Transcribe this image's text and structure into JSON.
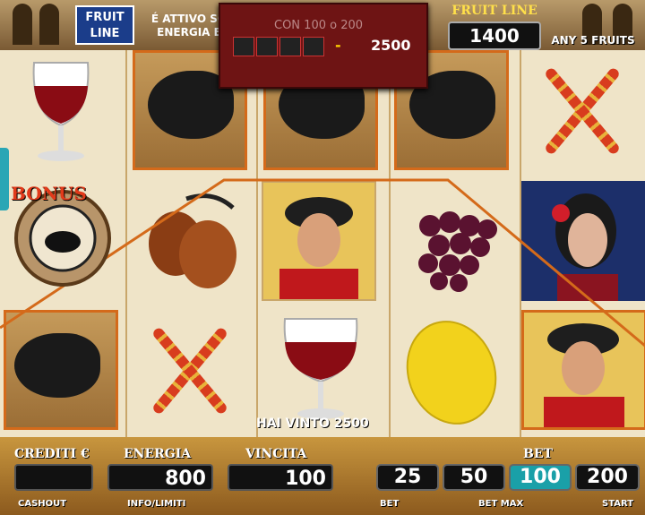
{
  "header": {
    "logo_line1": "FRUIT",
    "logo_line2": "LINE",
    "promo_line1": "É ATTIVO SO",
    "promo_line2": "ENERGIA E"
  },
  "win_popup": {
    "ghost_text": "CON  100 o 200",
    "symbol_count": 4,
    "symbol_icon": "bull-icon",
    "dash": "-",
    "payout": "2500"
  },
  "fruit_line": {
    "title": "FRUIT LINE",
    "value": "1400",
    "caption": "ANY 5 FRUITS"
  },
  "reels": [
    [
      "wine-glass",
      "bonus-wheel",
      "bull"
    ],
    [
      "bull",
      "castanets",
      "skewers"
    ],
    [
      "bull",
      "torero",
      "wine-glass"
    ],
    [
      "bull",
      "grapes",
      "lemon"
    ],
    [
      "skewers",
      "flamenco-woman",
      "torero"
    ]
  ],
  "bonus_label": "BONUS",
  "win_message": "HAI VINTO 2500",
  "meters": {
    "credits_label": "CREDITI €",
    "credits_value": "",
    "energy_label": "ENERGIA",
    "energy_value": "800",
    "win_label": "VINCITA",
    "win_value": "100",
    "bet_label": "BET"
  },
  "bets": [
    {
      "value": "25",
      "selected": false
    },
    {
      "value": "50",
      "selected": false
    },
    {
      "value": "100",
      "selected": true
    },
    {
      "value": "200",
      "selected": false
    }
  ],
  "footer": {
    "cashout": "CASHOUT",
    "info": "INFO/LIMITI",
    "bet": "BET",
    "betmax": "BET MAX",
    "start": "START"
  },
  "colors": {
    "highlight": "#d46a1a",
    "selected_bet": "#1aa0a8",
    "popup_bg": "#6e1414",
    "fruit_line_title": "#ffe04a"
  }
}
